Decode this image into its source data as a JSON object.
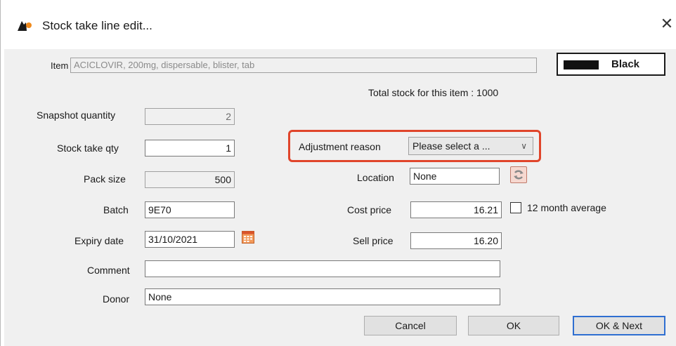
{
  "window": {
    "title": "Stock take line edit...",
    "close_symbol": "✕"
  },
  "item": {
    "label": "Item",
    "value": "ACICLOVIR, 200mg, dispersable, blister, tab"
  },
  "color_tag": {
    "label": "Black",
    "swatch_color": "#111111"
  },
  "total_stock": "Total stock for this item : 1000",
  "fields": {
    "snapshot_quantity": {
      "label": "Snapshot quantity",
      "value": "2"
    },
    "stock_take_qty": {
      "label": "Stock take qty",
      "value": "1"
    },
    "pack_size": {
      "label": "Pack size",
      "value": "500"
    },
    "batch": {
      "label": "Batch",
      "value": "9E70"
    },
    "expiry_date": {
      "label": "Expiry date",
      "value": "31/10/2021"
    },
    "comment": {
      "label": "Comment",
      "value": ""
    },
    "donor": {
      "label": "Donor",
      "value": "None"
    },
    "adjustment_reason": {
      "label": "Adjustment reason",
      "value": "Please select a ..."
    },
    "location": {
      "label": "Location",
      "value": "None"
    },
    "cost_price": {
      "label": "Cost price",
      "value": "16.21"
    },
    "sell_price": {
      "label": "Sell price",
      "value": "16.20"
    },
    "twelve_month_average": {
      "label": "12 month average",
      "checked": false
    }
  },
  "buttons": {
    "cancel": "Cancel",
    "ok": "OK",
    "ok_next": "OK & Next"
  },
  "colors": {
    "highlight": "#e0452b",
    "default_button_border": "#2f6fd1"
  }
}
